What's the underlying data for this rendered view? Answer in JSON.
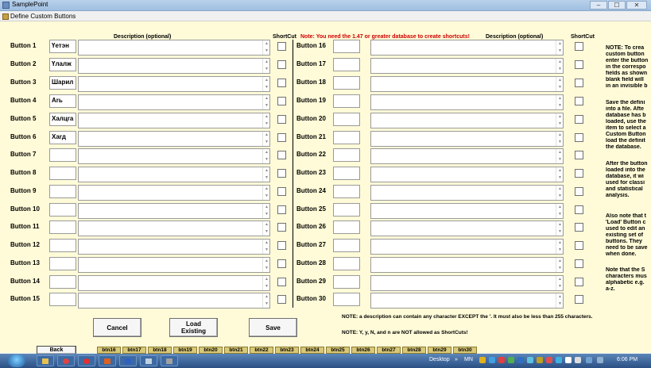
{
  "window": {
    "app_title": "SamplePoint",
    "dialog_title": "Define Custom Buttons",
    "controls": [
      "–",
      "☐",
      "✕"
    ]
  },
  "headers": {
    "desc_left": "Description (optional)",
    "shortcut_left": "ShortCut",
    "note": "Note: You need the 1.47 or greater database to create shortcuts!",
    "desc_right": "Description (optional)",
    "shortcut_right": "ShortCut"
  },
  "buttons_left": [
    {
      "label": "Button 1",
      "short": "Үетэн"
    },
    {
      "label": "Button 2",
      "short": "Үлалж"
    },
    {
      "label": "Button 3",
      "short": "Шарил"
    },
    {
      "label": "Button 4",
      "short": "Аrь"
    },
    {
      "label": "Button 5",
      "short": "Халцrа"
    },
    {
      "label": "Button 6",
      "short": "Хаrд"
    },
    {
      "label": "Button 7",
      "short": ""
    },
    {
      "label": "Button 8",
      "short": ""
    },
    {
      "label": "Button 9",
      "short": ""
    },
    {
      "label": "Button 10",
      "short": ""
    },
    {
      "label": "Button 11",
      "short": ""
    },
    {
      "label": "Button 12",
      "short": ""
    },
    {
      "label": "Button 13",
      "short": ""
    },
    {
      "label": "Button 14",
      "short": ""
    },
    {
      "label": "Button 15",
      "short": ""
    }
  ],
  "buttons_right": [
    {
      "label": "Button 16",
      "short": ""
    },
    {
      "label": "Button 17",
      "short": ""
    },
    {
      "label": "Button 18",
      "short": ""
    },
    {
      "label": "Button 19",
      "short": ""
    },
    {
      "label": "Button 20",
      "short": ""
    },
    {
      "label": "Button 21",
      "short": ""
    },
    {
      "label": "Button 22",
      "short": ""
    },
    {
      "label": "Button 23",
      "short": ""
    },
    {
      "label": "Button 24",
      "short": ""
    },
    {
      "label": "Button 25",
      "short": ""
    },
    {
      "label": "Button 26",
      "short": ""
    },
    {
      "label": "Button 27",
      "short": ""
    },
    {
      "label": "Button 28",
      "short": ""
    },
    {
      "label": "Button 29",
      "short": ""
    },
    {
      "label": "Button 30",
      "short": ""
    }
  ],
  "side_notes": [
    [
      "NOTE: To crea",
      "custom button",
      "enter the button",
      "in the correspo",
      "fields as shown",
      "blank field will",
      "in an invisible b"
    ],
    [
      "Save the defini",
      "into a file.  Afte",
      "database has b",
      "loaded, use the",
      "item to select a",
      "Custom Button",
      "load the definit",
      "the database."
    ],
    [
      "After the button",
      "loaded into the",
      "database, it wi",
      "used for classi",
      "and statistical",
      "analysis."
    ],
    [
      "Also note that t",
      "'Load' Button c",
      "used to edit an",
      "existing set of",
      "buttons.  They",
      "need to be save",
      "when done."
    ],
    [
      "Note that the S",
      "characters mus",
      "alphabetic e.g.",
      "a-z."
    ]
  ],
  "actions": {
    "cancel": "Cancel",
    "load_line1": "Load",
    "load_line2": "Existing",
    "save": "Save"
  },
  "bottom_notes": {
    "note1": "NOTE: a description can contain any character EXCEPT the '.  It must also be less than 255 characters.",
    "note2": "NOTE: Y, y, N, and n are NOT allowed as ShortCuts!"
  },
  "tabs": {
    "back": "Back",
    "items": [
      "btn16",
      "btn17",
      "btn18",
      "btn19",
      "btn20",
      "btn21",
      "btn22",
      "btn23",
      "btn24",
      "btn25",
      "btn26",
      "btn27",
      "btn28",
      "btn29",
      "btn30"
    ]
  },
  "taskbar": {
    "desktop": "Desktop",
    "chevron": "»",
    "lang": "MN",
    "time": "6:06 PM"
  }
}
